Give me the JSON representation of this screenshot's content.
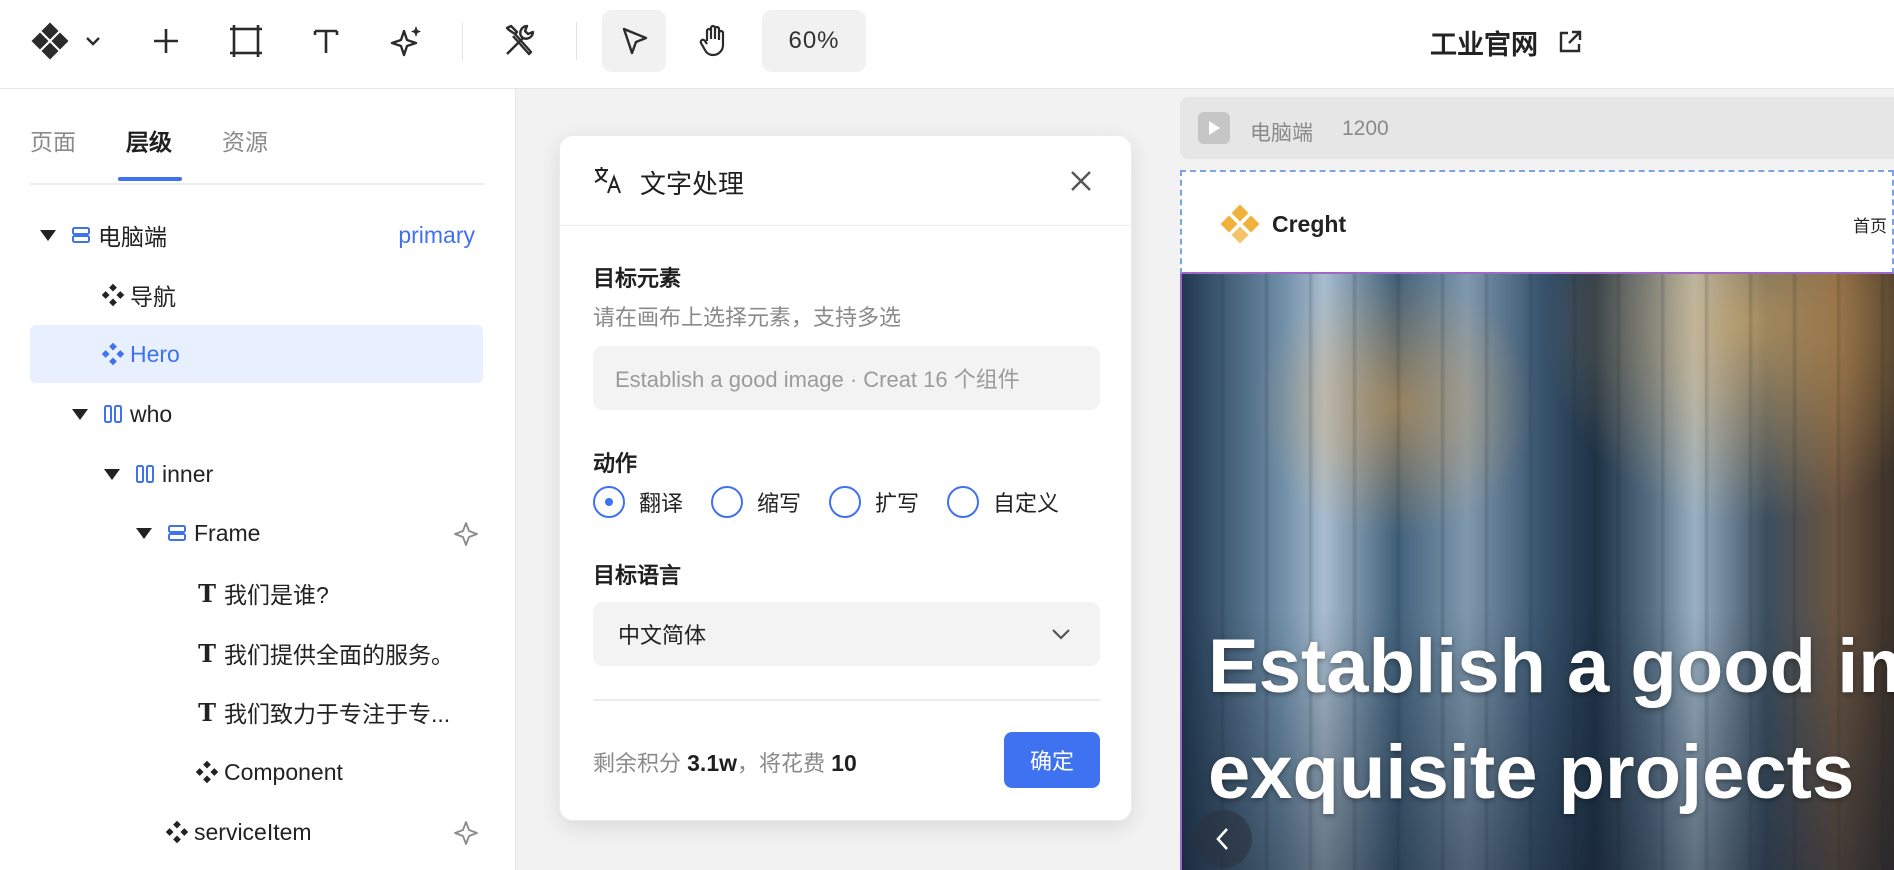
{
  "toolbar": {
    "zoom": "60%",
    "project_title": "工业官网"
  },
  "left_panel": {
    "tabs": [
      "页面",
      "层级",
      "资源"
    ],
    "active_tab": "层级",
    "tree": [
      {
        "label": "电脑端",
        "tag": "primary"
      },
      {
        "label": "导航"
      },
      {
        "label": "Hero"
      },
      {
        "label": "who"
      },
      {
        "label": "inner"
      },
      {
        "label": "Frame"
      },
      {
        "label": "我们是谁?"
      },
      {
        "label": "我们提供全面的服务。"
      },
      {
        "label": "我们致力于专注于专..."
      },
      {
        "label": "Component"
      },
      {
        "label": "serviceItem"
      }
    ]
  },
  "dialog": {
    "title": "文字处理",
    "target_label": "目标元素",
    "target_hint": "请在画布上选择元素，支持多选",
    "target_value": "Establish a good image · Creat  16 个组件",
    "action_label": "动作",
    "actions": [
      "翻译",
      "缩写",
      "扩写",
      "自定义"
    ],
    "selected_action": "翻译",
    "language_label": "目标语言",
    "language_value": "中文简体",
    "credit_prefix": "剩余积分",
    "credit_amount": "3.1w",
    "credit_mid": "，将花费",
    "credit_cost": "10",
    "confirm_label": "确定"
  },
  "preview": {
    "device_label": "电脑端",
    "width": "1200",
    "brand": "Creght",
    "nav_home": "首页",
    "hero_line1": "Establish a good im",
    "hero_line2": "exquisite projects"
  },
  "colors": {
    "accent": "#3f72f0",
    "selection_bg": "#e8efff",
    "brand_logo": "#f0b23c"
  }
}
